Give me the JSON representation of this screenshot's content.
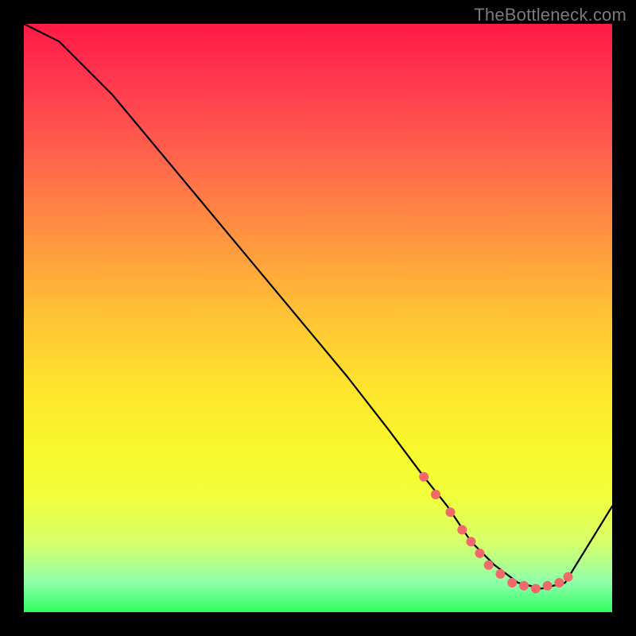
{
  "watermark": "TheBottleneck.com",
  "chart_data": {
    "type": "line",
    "title": "",
    "xlabel": "",
    "ylabel": "",
    "xlim": [
      0,
      100
    ],
    "ylim": [
      0,
      100
    ],
    "curve": {
      "x": [
        0,
        6,
        15,
        25,
        35,
        45,
        55,
        62,
        68,
        72,
        76,
        80,
        84,
        88,
        92,
        100
      ],
      "y": [
        100,
        97,
        88,
        76,
        64,
        52,
        40,
        31,
        23,
        18,
        12,
        8,
        5,
        4,
        5,
        18
      ]
    },
    "markers": {
      "x": [
        68.0,
        70.0,
        72.5,
        74.5,
        76.0,
        77.5,
        79.0,
        81.0,
        83.0,
        85.0,
        87.0,
        89.0,
        91.0,
        92.5
      ],
      "y": [
        23.0,
        20.0,
        17.0,
        14.0,
        12.0,
        10.0,
        8.0,
        6.5,
        5.0,
        4.5,
        4.0,
        4.5,
        5.0,
        6.0
      ]
    },
    "marker_color": "#f06a6a",
    "line_color": "#000000",
    "legend": null,
    "grid": false
  }
}
